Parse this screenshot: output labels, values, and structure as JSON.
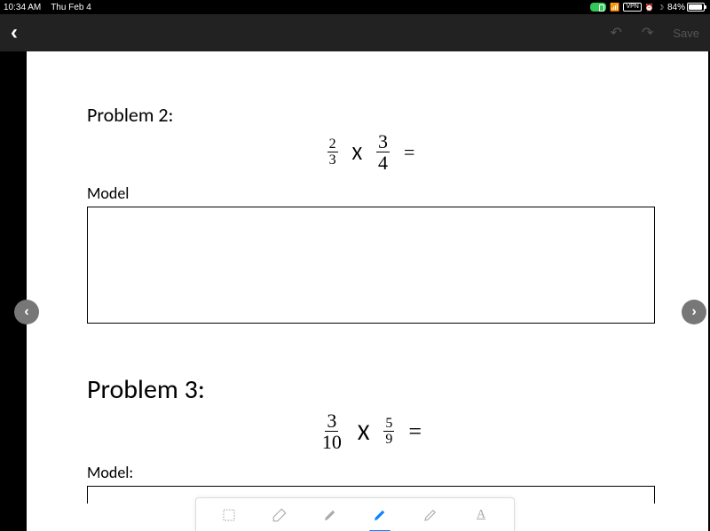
{
  "status": {
    "time": "10:34 AM",
    "date": "Thu Feb 4",
    "vpn": "VPN",
    "battery_pct": "84%"
  },
  "appbar": {
    "undo": "↶",
    "redo": "↷",
    "save": "Save"
  },
  "nav": {
    "prev": "‹",
    "next": "›"
  },
  "content": {
    "p2": {
      "title": "Problem 2:",
      "f1n": "2",
      "f1d": "3",
      "op": "X",
      "f2n": "3",
      "f2d": "4",
      "eq": "=",
      "model": "Model"
    },
    "p3": {
      "title": "Problem 3:",
      "f1n": "3",
      "f1d": "10",
      "op": "X",
      "f2n": "5",
      "f2d": "9",
      "eq": "=",
      "model": "Model:"
    }
  },
  "tools": {
    "text_tool": "A"
  }
}
